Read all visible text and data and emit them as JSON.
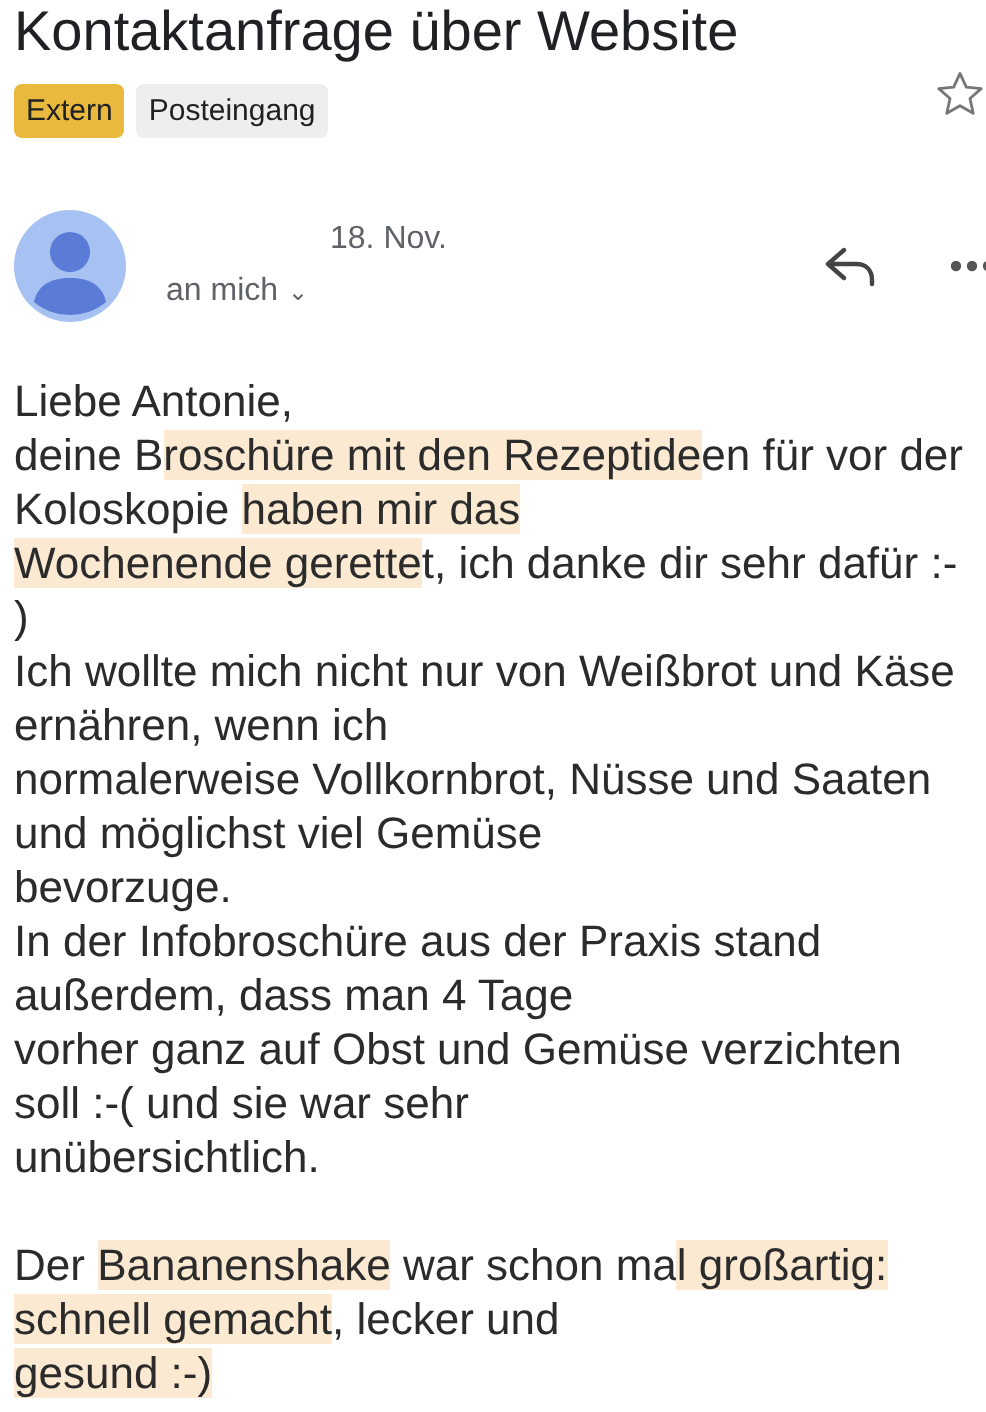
{
  "subject": "Kontaktanfrage über Website",
  "labels": [
    {
      "text": "Extern",
      "kind": "external"
    },
    {
      "text": "Posteingang",
      "kind": "folder"
    }
  ],
  "starred": false,
  "message": {
    "date": "18. Nov.",
    "recipient": "an mich",
    "recipient_caret": "⌄"
  },
  "body_paragraphs": [
    {
      "lines": [
        [
          {
            "text": "Liebe Antonie,",
            "highlighted": false
          }
        ],
        [
          {
            "text": "deine B",
            "highlighted": false
          },
          {
            "text": "roschüre mit den Rezeptide",
            "highlighted": true
          },
          {
            "text": "en für vor der",
            "highlighted": false
          }
        ],
        [
          {
            "text": "Koloskopie ",
            "highlighted": false
          },
          {
            "text": "haben mir das",
            "highlighted": true
          }
        ],
        [
          {
            "text": "Wochenende gerette",
            "highlighted": true
          },
          {
            "text": "t, ich danke dir sehr dafür :-",
            "highlighted": false
          }
        ],
        [
          {
            "text": ")",
            "highlighted": false
          }
        ],
        [
          {
            "text": "Ich wollte mich nicht nur von Weißbrot und Käse",
            "highlighted": false
          }
        ],
        [
          {
            "text": "ernähren, wenn ich",
            "highlighted": false
          }
        ],
        [
          {
            "text": "normalerweise Vollkornbrot, Nüsse und Saaten",
            "highlighted": false
          }
        ],
        [
          {
            "text": "und möglichst viel Gemüse",
            "highlighted": false
          }
        ],
        [
          {
            "text": "bevorzuge.",
            "highlighted": false
          }
        ],
        [
          {
            "text": "In der Infobroschüre aus der Praxis stand",
            "highlighted": false
          }
        ],
        [
          {
            "text": "außerdem, dass man 4 Tage",
            "highlighted": false
          }
        ],
        [
          {
            "text": "vorher ganz auf Obst und Gemüse verzichten",
            "highlighted": false
          }
        ],
        [
          {
            "text": "soll :-( und sie war sehr",
            "highlighted": false
          }
        ],
        [
          {
            "text": "unübersichtlich.",
            "highlighted": false
          }
        ]
      ]
    },
    {
      "lines": [
        [
          {
            "text": "Der ",
            "highlighted": false
          },
          {
            "text": "Bananenshake",
            "highlighted": true
          },
          {
            "text": " war schon ma",
            "highlighted": false
          },
          {
            "text": "l großartig:",
            "highlighted": true
          }
        ],
        [
          {
            "text": "schnell gemacht",
            "highlighted": true
          },
          {
            "text": ", lecker und",
            "highlighted": false
          }
        ],
        [
          {
            "text": "gesund :-)",
            "highlighted": true
          }
        ]
      ]
    }
  ]
}
